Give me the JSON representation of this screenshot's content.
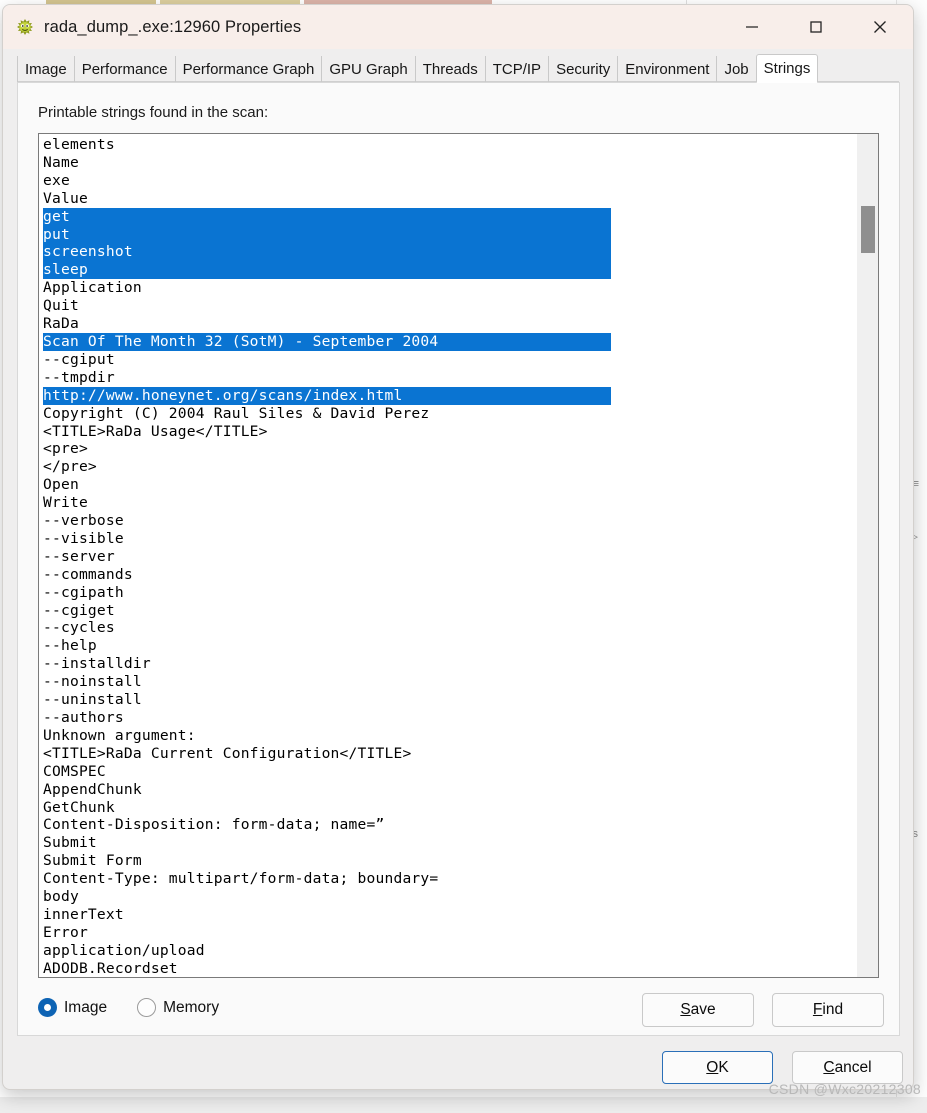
{
  "window": {
    "title": "rada_dump_.exe:12960 Properties",
    "icon": "pufferfish-icon",
    "controls": {
      "minimize": "minimize-icon",
      "maximize": "maximize-icon",
      "close": "close-icon"
    }
  },
  "tabs": [
    {
      "label": "Image",
      "active": false
    },
    {
      "label": "Performance",
      "active": false
    },
    {
      "label": "Performance Graph",
      "active": false
    },
    {
      "label": "GPU Graph",
      "active": false
    },
    {
      "label": "Threads",
      "active": false
    },
    {
      "label": "TCP/IP",
      "active": false
    },
    {
      "label": "Security",
      "active": false
    },
    {
      "label": "Environment",
      "active": false
    },
    {
      "label": "Job",
      "active": false
    },
    {
      "label": "Strings",
      "active": true
    }
  ],
  "page": {
    "list_label": "Printable strings found in the scan:",
    "strings": [
      {
        "text": "elements",
        "selected": false
      },
      {
        "text": "Name",
        "selected": false
      },
      {
        "text": "exe",
        "selected": false
      },
      {
        "text": "Value",
        "selected": false
      },
      {
        "text": "get",
        "selected": true
      },
      {
        "text": "put",
        "selected": true
      },
      {
        "text": "screenshot",
        "selected": true
      },
      {
        "text": "sleep",
        "selected": true
      },
      {
        "text": "Application",
        "selected": false
      },
      {
        "text": "Quit",
        "selected": false
      },
      {
        "text": "RaDa",
        "selected": false
      },
      {
        "text": "Scan Of The Month 32 (SotM) - September 2004",
        "selected": true
      },
      {
        "text": "--cgiput",
        "selected": false
      },
      {
        "text": "--tmpdir",
        "selected": false
      },
      {
        "text": "http://www.honeynet.org/scans/index.html",
        "selected": true
      },
      {
        "text": "Copyright (C) 2004 Raul Siles & David Perez",
        "selected": false
      },
      {
        "text": "<TITLE>RaDa Usage</TITLE>",
        "selected": false
      },
      {
        "text": "<pre>",
        "selected": false
      },
      {
        "text": "</pre>",
        "selected": false
      },
      {
        "text": "Open",
        "selected": false
      },
      {
        "text": "Write",
        "selected": false
      },
      {
        "text": "--verbose",
        "selected": false
      },
      {
        "text": "--visible",
        "selected": false
      },
      {
        "text": "--server",
        "selected": false
      },
      {
        "text": "--commands",
        "selected": false
      },
      {
        "text": "--cgipath",
        "selected": false
      },
      {
        "text": "--cgiget",
        "selected": false
      },
      {
        "text": "--cycles",
        "selected": false
      },
      {
        "text": "--help",
        "selected": false
      },
      {
        "text": "--installdir",
        "selected": false
      },
      {
        "text": "--noinstall",
        "selected": false
      },
      {
        "text": "--uninstall",
        "selected": false
      },
      {
        "text": "--authors",
        "selected": false
      },
      {
        "text": "Unknown argument:",
        "selected": false
      },
      {
        "text": "<TITLE>RaDa Current Configuration</TITLE>",
        "selected": false
      },
      {
        "text": "COMSPEC",
        "selected": false
      },
      {
        "text": "AppendChunk",
        "selected": false
      },
      {
        "text": "GetChunk",
        "selected": false
      },
      {
        "text": "Content-Disposition: form-data; name=”",
        "selected": false
      },
      {
        "text": "Submit",
        "selected": false
      },
      {
        "text": "Submit Form",
        "selected": false
      },
      {
        "text": "Content-Type: multipart/form-data; boundary=",
        "selected": false
      },
      {
        "text": "body",
        "selected": false
      },
      {
        "text": "innerText",
        "selected": false
      },
      {
        "text": "Error",
        "selected": false
      },
      {
        "text": "application/upload",
        "selected": false
      },
      {
        "text": "ADODB.Recordset",
        "selected": false
      }
    ],
    "source_options": [
      {
        "label": "Image",
        "selected": true
      },
      {
        "label": "Memory",
        "selected": false
      }
    ],
    "save_label": "Save",
    "find_label": "Find"
  },
  "footer": {
    "ok_label": "OK",
    "cancel_label": "Cancel"
  },
  "watermark": "CSDN @Wxc20212308",
  "colors": {
    "selection_blue": "#0a74d2",
    "title_bar": "#f8eeea",
    "dialog_face": "#efeeee",
    "focus_border": "#2a6fb8"
  }
}
